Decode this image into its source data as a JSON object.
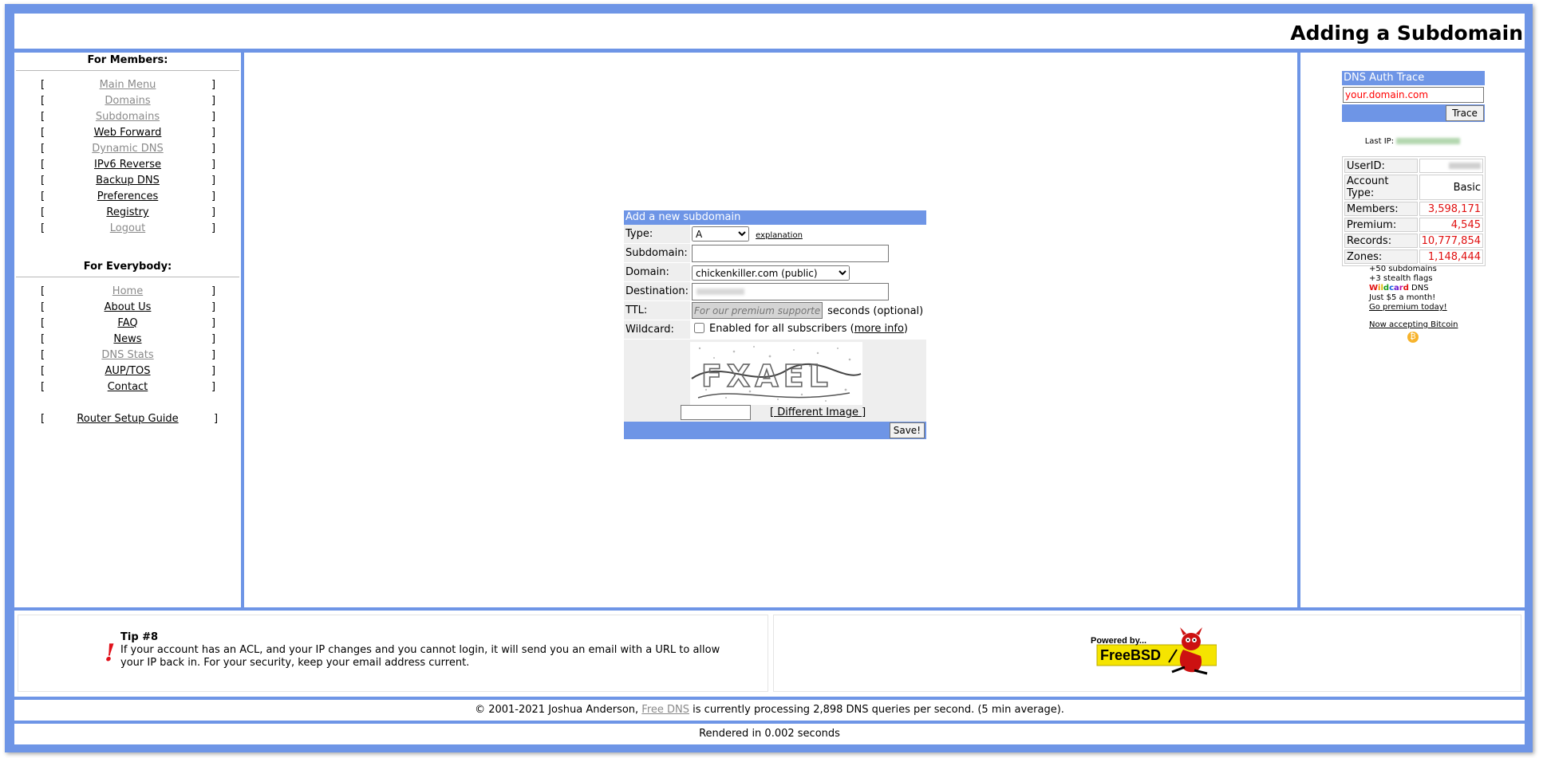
{
  "page_title": "Adding a Subdomain",
  "members_nav": {
    "heading": "For Members:",
    "items": [
      {
        "label": "Main Menu",
        "style": "grey"
      },
      {
        "label": "Domains",
        "style": "grey"
      },
      {
        "label": "Subdomains",
        "style": "grey"
      },
      {
        "label": "Web Forward",
        "style": "dark"
      },
      {
        "label": "Dynamic DNS",
        "style": "grey"
      },
      {
        "label": "IPv6 Reverse",
        "style": "dark"
      },
      {
        "label": "Backup DNS",
        "style": "dark"
      },
      {
        "label": "Preferences",
        "style": "dark"
      },
      {
        "label": "Registry",
        "style": "dark"
      },
      {
        "label": "Logout",
        "style": "grey"
      }
    ]
  },
  "everybody_nav": {
    "heading": "For Everybody:",
    "items": [
      {
        "label": "Home",
        "style": "grey"
      },
      {
        "label": "About Us",
        "style": "dark"
      },
      {
        "label": "FAQ",
        "style": "dark"
      },
      {
        "label": "News",
        "style": "dark"
      },
      {
        "label": "DNS Stats",
        "style": "grey"
      },
      {
        "label": "AUP/TOS",
        "style": "dark"
      },
      {
        "label": "Contact",
        "style": "dark"
      }
    ],
    "router_guide": "Router Setup Guide"
  },
  "bracket_left": "[",
  "bracket_right": "]",
  "form": {
    "title": "Add a new subdomain",
    "type_label": "Type:",
    "type_value": "A",
    "explanation_link": "explanation",
    "subdomain_label": "Subdomain:",
    "subdomain_value": "",
    "domain_label": "Domain:",
    "domain_value": "chickenkiller.com (public)",
    "destination_label": "Destination:",
    "ttl_label": "TTL:",
    "ttl_placeholder": "For our premium supporters",
    "ttl_suffix": "seconds (optional)",
    "wildcard_label": "Wildcard:",
    "wildcard_text": "Enabled for all subscribers (",
    "wildcard_more": "more info",
    "wildcard_close": ")",
    "captcha_text": "FXAEL",
    "captcha_input": "",
    "different_image": "[ Different Image ]",
    "save_button": "Save!"
  },
  "trace": {
    "title": "DNS Auth Trace",
    "input_value": "your.domain.com",
    "button": "Trace"
  },
  "last_ip_label": "Last IP:",
  "stats": [
    {
      "label": "UserID:",
      "value": ""
    },
    {
      "label": "Account Type:",
      "value": "Basic"
    },
    {
      "label": "Members:",
      "value": "3,598,171"
    },
    {
      "label": "Premium:",
      "value": "4,545"
    },
    {
      "label": "Records:",
      "value": "10,777,854"
    },
    {
      "label": "Zones:",
      "value": "1,148,444"
    }
  ],
  "promo": {
    "line1": "+50 subdomains",
    "line2": "+3 stealth flags",
    "wildcard_word": "Wildcard",
    "line3_suffix": " DNS",
    "line4": "Just $5 a month!",
    "link": "Go premium today!",
    "bitcoin_link": "Now accepting Bitcoin",
    "bitcoin_symbol": "₿"
  },
  "tip": {
    "heading": "Tip #8",
    "text": "If your account has an ACL, and your IP changes and you cannot login, it will send you an email with a URL to allow your IP back in. For your security, keep your email address current.",
    "bang": "!"
  },
  "freebsd": {
    "powered_by": "Powered by...",
    "name": "FreeBSD"
  },
  "footer": {
    "copyright_prefix": "© 2001-2021 Joshua Anderson, ",
    "link": "Free DNS",
    "copyright_suffix": " is currently processing 2,898 DNS queries per second. (5 min average).",
    "rendered": "Rendered in 0.002 seconds"
  },
  "colors": {
    "frame_blue": "#6e95e6",
    "stat_red": "#e01010",
    "tip_red": "#e0101a"
  }
}
